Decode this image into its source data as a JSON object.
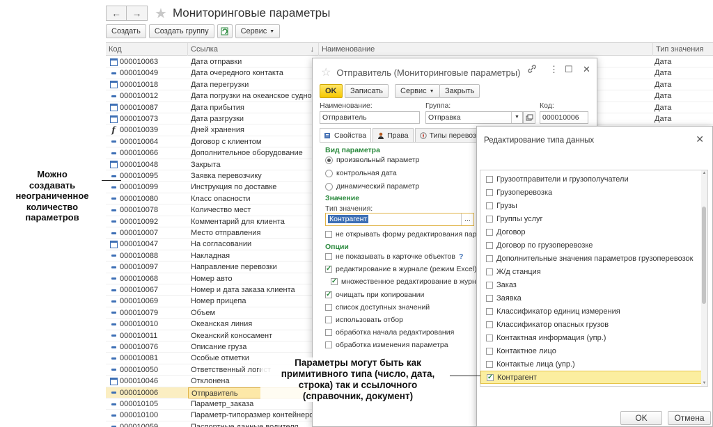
{
  "header": {
    "back_icon": "←",
    "forward_icon": "→",
    "star_icon": "★",
    "title": "Мониторинговые параметры"
  },
  "toolbar": {
    "create": "Создать",
    "create_group": "Создать группу",
    "service": "Сервис"
  },
  "columns": {
    "code": "Код",
    "ref": "Ссылка",
    "sort": "↓",
    "name": "Наименование",
    "type": "Тип значения"
  },
  "rows": [
    {
      "icon": "calendar",
      "code": "000010063",
      "ref": "Дата отправки",
      "name": "",
      "type": "Дата"
    },
    {
      "icon": "dash",
      "code": "000010049",
      "ref": "Дата очередного контакта",
      "name": "",
      "type": "Дата"
    },
    {
      "icon": "calendar",
      "code": "000010018",
      "ref": "Дата перегрузки",
      "name": "",
      "type": "Дата"
    },
    {
      "icon": "dash",
      "code": "000010012",
      "ref": "Дата погрузки на океанское судно",
      "name": "",
      "type": "Дата"
    },
    {
      "icon": "calendar",
      "code": "000010087",
      "ref": "Дата прибытия",
      "name": "",
      "type": "Дата"
    },
    {
      "icon": "calendar",
      "code": "000010073",
      "ref": "Дата разгрузки",
      "name": "",
      "type": "Дата"
    },
    {
      "icon": "f",
      "code": "000010039",
      "ref": "Дней хранения",
      "name": "",
      "type": ""
    },
    {
      "icon": "dash",
      "code": "000010064",
      "ref": "Договор с клиентом",
      "name": "",
      "type": ""
    },
    {
      "icon": "dash",
      "code": "000010066",
      "ref": "Дополнительное оборудование",
      "name": "",
      "type": ""
    },
    {
      "icon": "calendar",
      "code": "000010048",
      "ref": "Закрыта",
      "name": "",
      "type": ""
    },
    {
      "icon": "dash",
      "code": "000010095",
      "ref": "Заявка перевозчику",
      "name": "",
      "type": ""
    },
    {
      "icon": "dash",
      "code": "000010099",
      "ref": "Инструкция по доставке",
      "name": "",
      "type": ""
    },
    {
      "icon": "dash",
      "code": "000010080",
      "ref": "Класс опасности",
      "name": "",
      "type": ""
    },
    {
      "icon": "dash",
      "code": "000010078",
      "ref": "Количество мест",
      "name": "",
      "type": ""
    },
    {
      "icon": "dash",
      "code": "000010092",
      "ref": "Комментарий для клиента",
      "name": "",
      "type": ""
    },
    {
      "icon": "dash",
      "code": "000010007",
      "ref": "Место отправления",
      "name": "",
      "type": ""
    },
    {
      "icon": "calendar",
      "code": "000010047",
      "ref": "На согласовании",
      "name": "",
      "type": ""
    },
    {
      "icon": "dash",
      "code": "000010088",
      "ref": "Накладная",
      "name": "",
      "type": ""
    },
    {
      "icon": "dash",
      "code": "000010097",
      "ref": "Направление перевозки",
      "name": "",
      "type": ""
    },
    {
      "icon": "dash",
      "code": "000010068",
      "ref": "Номер авто",
      "name": "",
      "type": ""
    },
    {
      "icon": "dash",
      "code": "000010067",
      "ref": "Номер и дата заказа клиента",
      "name": "",
      "type": ""
    },
    {
      "icon": "dash",
      "code": "000010069",
      "ref": "Номер прицепа",
      "name": "",
      "type": ""
    },
    {
      "icon": "dash",
      "code": "000010079",
      "ref": "Объем",
      "name": "",
      "type": ""
    },
    {
      "icon": "dash",
      "code": "000010010",
      "ref": "Океанская линия",
      "name": "",
      "type": ""
    },
    {
      "icon": "dash",
      "code": "000010011",
      "ref": "Океанский коносамент",
      "name": "",
      "type": ""
    },
    {
      "icon": "dash",
      "code": "000010076",
      "ref": "Описание груза",
      "name": "",
      "type": ""
    },
    {
      "icon": "dash",
      "code": "000010081",
      "ref": "Особые отметки",
      "name": "",
      "type": ""
    },
    {
      "icon": "dash",
      "code": "000010050",
      "ref": "Ответственный логист",
      "name": "",
      "type": ""
    },
    {
      "icon": "calendar",
      "code": "000010046",
      "ref": "Отклонена",
      "name": "",
      "type": ""
    },
    {
      "icon": "dash",
      "code": "000010006",
      "ref": "Отправитель",
      "name": "",
      "type": "",
      "selected": true
    },
    {
      "icon": "dash",
      "code": "000010105",
      "ref": "Параметр_заказа",
      "name": "",
      "type": ""
    },
    {
      "icon": "dash",
      "code": "000010100",
      "ref": "Параметр-типоразмер контейнеров",
      "name": "",
      "type": ""
    },
    {
      "icon": "dash",
      "code": "000010059",
      "ref": "Паспортные данные водителя",
      "name": "Паспортные данные водителя",
      "type": ""
    }
  ],
  "annotations": {
    "left": [
      "Можно",
      "создавать",
      "неограниченное",
      "количество",
      "параметров"
    ],
    "bottom": [
      "Параметры могут быть как",
      "примитивного типа (число, дата,",
      "строка) так и ссылочного",
      "(справочник, документ)"
    ]
  },
  "sender_dialog": {
    "title": "Отправитель (Мониторинговые параметры)",
    "icons": {
      "star": "☆",
      "link": "🔗",
      "more": "⋮",
      "maximize": "☐",
      "close": "✕"
    },
    "buttons": {
      "ok": "OK",
      "save": "Записать",
      "service": "Сервис",
      "close": "Закрыть"
    },
    "fields": {
      "name_label": "Наименование:",
      "name_value": "Отправитель",
      "group_label": "Группа:",
      "group_value": "Отправка",
      "code_label": "Код:",
      "code_value": "000010006"
    },
    "tabs": [
      "Свойства",
      "Права",
      "Типы перевозок"
    ],
    "param_section": "Вид параметра",
    "radios": [
      {
        "label": "произвольный параметр",
        "on": true
      },
      {
        "label": "контрольная дата",
        "on": false
      },
      {
        "label": "динамический параметр",
        "on": false
      }
    ],
    "value_section": "Значение",
    "type_label": "Тип значения:",
    "type_value": "Контрагент",
    "type_button": "...",
    "no_edit_form": "не открывать форму редактирования параметра",
    "options_section": "Опции",
    "options": [
      {
        "label": "не показывать в карточке объектов",
        "checked": false,
        "help": "?"
      },
      {
        "label": "редактирование в журнале (режим Excel)",
        "checked": true
      },
      {
        "label": "множественное редактирование в журнале",
        "checked": true,
        "indent": true
      },
      {
        "label": "очищать при копировании",
        "checked": true
      },
      {
        "label": "список доступных значений",
        "checked": false
      },
      {
        "label": "использовать отбор",
        "checked": false
      },
      {
        "label": "обработка начала редактирования",
        "checked": false
      },
      {
        "label": "обработка изменения параметра",
        "checked": false
      }
    ]
  },
  "type_dialog": {
    "title": "Редактирование типа данных",
    "close_icon": "✕",
    "items": [
      {
        "label": "Грузоотправители и грузополучатели",
        "checked": false
      },
      {
        "label": "Грузоперевозка",
        "checked": false
      },
      {
        "label": "Грузы",
        "checked": false
      },
      {
        "label": "Группы услуг",
        "checked": false
      },
      {
        "label": "Договор",
        "checked": false
      },
      {
        "label": "Договор по грузоперевозке",
        "checked": false
      },
      {
        "label": "Дополнительные значения параметров грузоперевозок",
        "checked": false
      },
      {
        "label": "Ж/д станция",
        "checked": false
      },
      {
        "label": "Заказ",
        "checked": false
      },
      {
        "label": "Заявка",
        "checked": false
      },
      {
        "label": "Классификатор единиц измерения",
        "checked": false
      },
      {
        "label": "Классификатор опасных грузов",
        "checked": false
      },
      {
        "label": "Контактная информация (упр.)",
        "checked": false
      },
      {
        "label": "Контактное лицо",
        "checked": false
      },
      {
        "label": "Контактые лица (упр.)",
        "checked": false
      },
      {
        "label": "Контрагент",
        "checked": true,
        "selected": true
      }
    ],
    "ok": "OK",
    "cancel": "Отмена"
  }
}
